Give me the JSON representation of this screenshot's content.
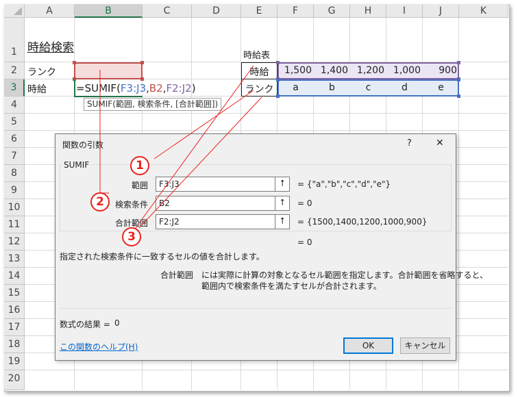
{
  "sheet": {
    "columns": [
      "A",
      "B",
      "C",
      "D",
      "E",
      "F",
      "G",
      "H",
      "I",
      "J",
      "K"
    ],
    "selected_column": "B",
    "rows": [
      "1",
      "2",
      "3",
      "4",
      "5",
      "6",
      "7",
      "8",
      "9",
      "10",
      "11",
      "12",
      "13",
      "14",
      "15",
      "16",
      "17",
      "18",
      "19",
      "20"
    ],
    "selected_row": "3",
    "title": "時給検索",
    "label_rank": "ランク",
    "label_wage": "時給",
    "formula_prefix": "=SUMIF(",
    "formula_arg1": "F3:J3",
    "formula_comma1": ",",
    "formula_arg2": "B2",
    "formula_comma2": ",",
    "formula_arg3": "F2:J2",
    "formula_suffix": ")",
    "tooltip": "SUMIF(範囲, 検索条件, [合計範囲])",
    "table_caption": "時給表",
    "table_row1_header": "時給",
    "table_row2_header": "ランク",
    "wages": [
      "1,500",
      "1,400",
      "1,200",
      "1,000",
      "900"
    ],
    "ranks": [
      "a",
      "b",
      "c",
      "d",
      "e"
    ]
  },
  "dialog": {
    "title": "関数の引数",
    "help_glyph": "?",
    "close_glyph": "✕",
    "function_name": "SUMIF",
    "arguments": [
      {
        "label": "範囲",
        "value": "F3:J3",
        "result": "= {\"a\",\"b\",\"c\",\"d\",\"e\"}"
      },
      {
        "label": "検索条件",
        "value": "B2",
        "result": "= 0"
      },
      {
        "label": "合計範囲",
        "value": "F2:J2",
        "result": "= {1500,1400,1200,1000,900}"
      }
    ],
    "ref_button_glyph": "⭡",
    "overall_result": "= 0",
    "description": "指定された検索条件に一致するセルの値を合計します。",
    "arg_help_label": "合計範囲",
    "arg_help_line1": "には実際に計算の対象となるセル範囲を指定します。合計範囲を省略すると、",
    "arg_help_line2": "範囲内で検索条件を満たすセルが合計されます。",
    "formula_result_label": "数式の結果 =",
    "formula_result_value": "0",
    "help_link": "この関数のヘルプ(H)",
    "ok_label": "OK",
    "cancel_label": "キャンセル"
  },
  "annotations": [
    "1",
    "2",
    "3"
  ],
  "colors": {
    "accent_red": "#e8231f",
    "range_blue": "#4472c4",
    "range_red": "#c0504d",
    "range_purple": "#8064a2",
    "excel_green": "#217346"
  }
}
